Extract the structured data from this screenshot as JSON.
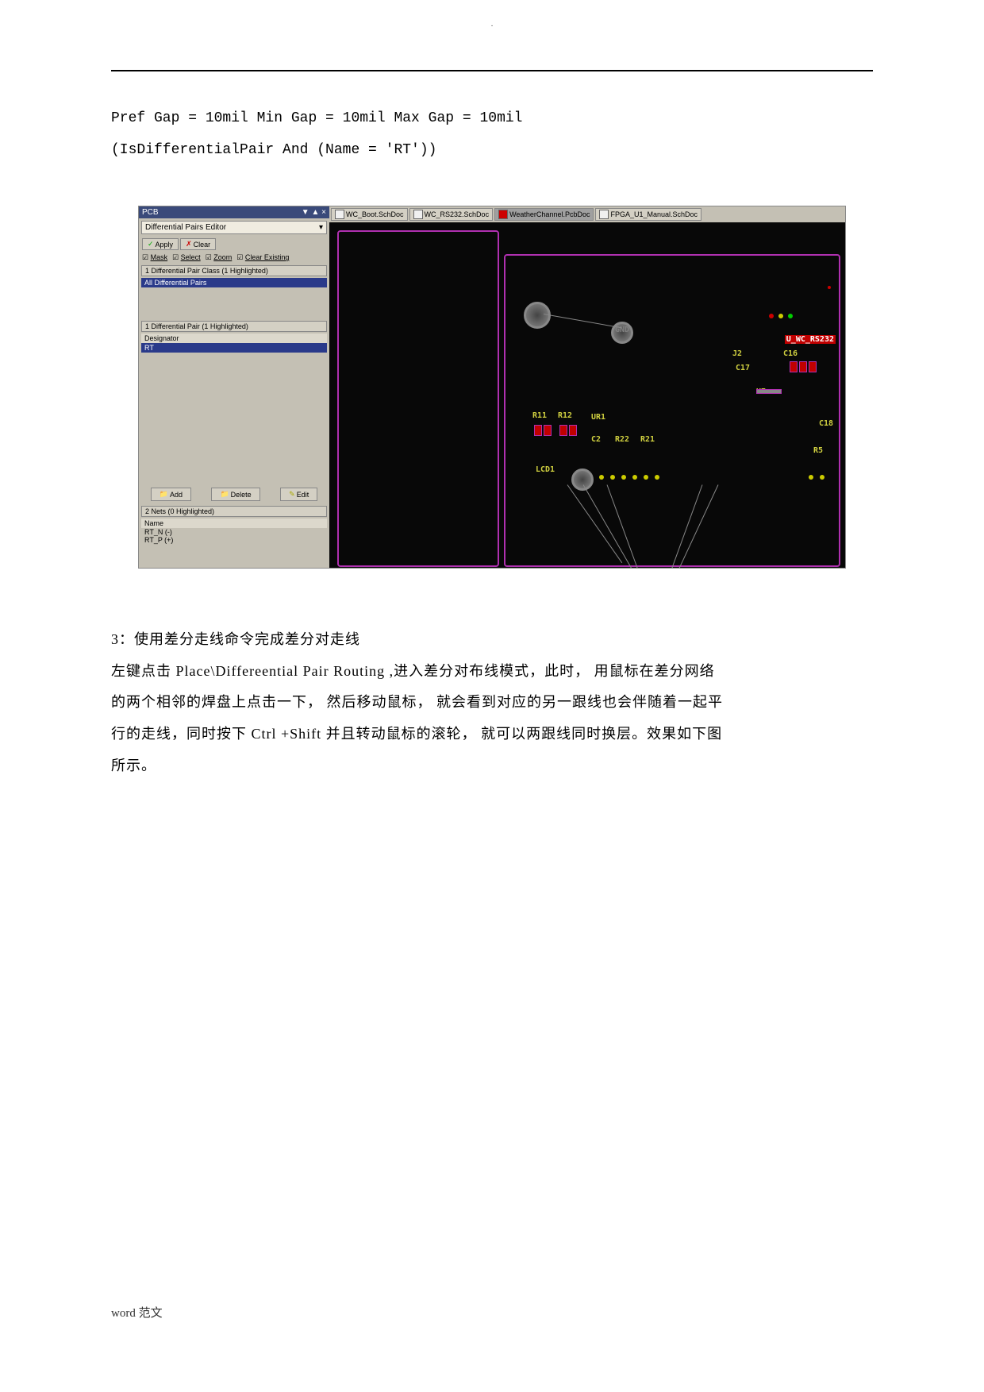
{
  "header_dot": ".",
  "code1": "Pref Gap = 10mil Min Gap = 10mil Max Gap = 10mil",
  "code2": "(IsDifferentialPair And (Name = 'RT'))",
  "panel": {
    "title": "PCB",
    "wincontrols": "▼ ▲ ×",
    "dropdown": "Differential Pairs Editor",
    "caret": "▾",
    "apply": "Apply",
    "clear": "Clear",
    "chk": {
      "mask": "Mask",
      "select": "Select",
      "zoom": "Zoom",
      "clrex": "Clear Existing"
    },
    "sec1": "1 Differential Pair Class (1 Highlighted)",
    "sel1": "All Differential Pairs",
    "sec2": "1 Differential Pair (1 Highlighted)",
    "desig": "Designator",
    "rt": "RT",
    "add": "Add",
    "delete": "Delete",
    "edit": "Edit",
    "sec3": "2 Nets (0 Highlighted)",
    "name": "Name",
    "n1": "RT_N (-)",
    "n2": "RT_P (+)"
  },
  "tabs": {
    "t1": "WC_Boot.SchDoc",
    "t2": "WC_RS232.SchDoc",
    "t3": "WeatherChannel.PcbDoc",
    "t4": "FPGA_U1_Manual.SchDoc"
  },
  "pcb": {
    "net1": "U_WC_RS232",
    "j2": "J2",
    "c16": "C16",
    "c17": "C17",
    "u7": "U7",
    "r11": "R11",
    "r12": "R12",
    "ur1": "UR1",
    "c2": "C2",
    "r22": "R22",
    "r21": "R21",
    "c18": "C18",
    "r5": "R5",
    "lcd1": "LCD1",
    "gnd": "GND"
  },
  "para": {
    "h3": "3：使用差分走线命令完成差分对走线",
    "p1": "左键点击 Place\\Differeential Pair Routing ,进入差分对布线模式，此时， 用鼠标在差分网络",
    "p2": "的两个相邻的焊盘上点击一下， 然后移动鼠标， 就会看到对应的另一跟线也会伴随着一起平",
    "p3": "行的走线，同时按下 Ctrl +Shift 并且转动鼠标的滚轮， 就可以两跟线同时换层。效果如下图",
    "p4": "所示。"
  },
  "footer": "word 范文"
}
